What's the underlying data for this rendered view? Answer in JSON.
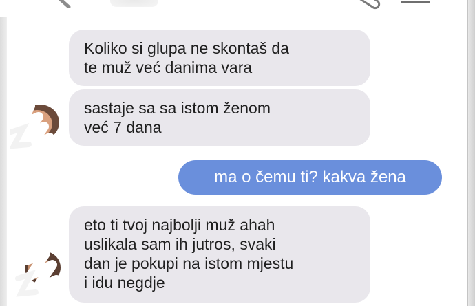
{
  "header": {
    "back_icon": "back-arrow-icon",
    "attach_icon": "paperclip-icon",
    "menu_icon": "menu-icon"
  },
  "messages": [
    {
      "direction": "incoming",
      "text": "Koliko si glupa ne skontaš da\nte muž već danima vara"
    },
    {
      "direction": "incoming",
      "text": "sastaje sa sa istom ženom\nveć 7 dana"
    },
    {
      "direction": "outgoing",
      "text": "ma o čemu ti? kakva žena"
    },
    {
      "direction": "incoming",
      "text": "eto ti tvoj najbolji muž ahah\nuslikala sam ih jutros, svaki\ndan je pokupi na istom mjestu\ni idu negdje"
    }
  ],
  "colors": {
    "incoming_bubble": "#e9e7ec",
    "outgoing_bubble": "#6a8fdc",
    "outgoing_text": "#ffffff"
  }
}
